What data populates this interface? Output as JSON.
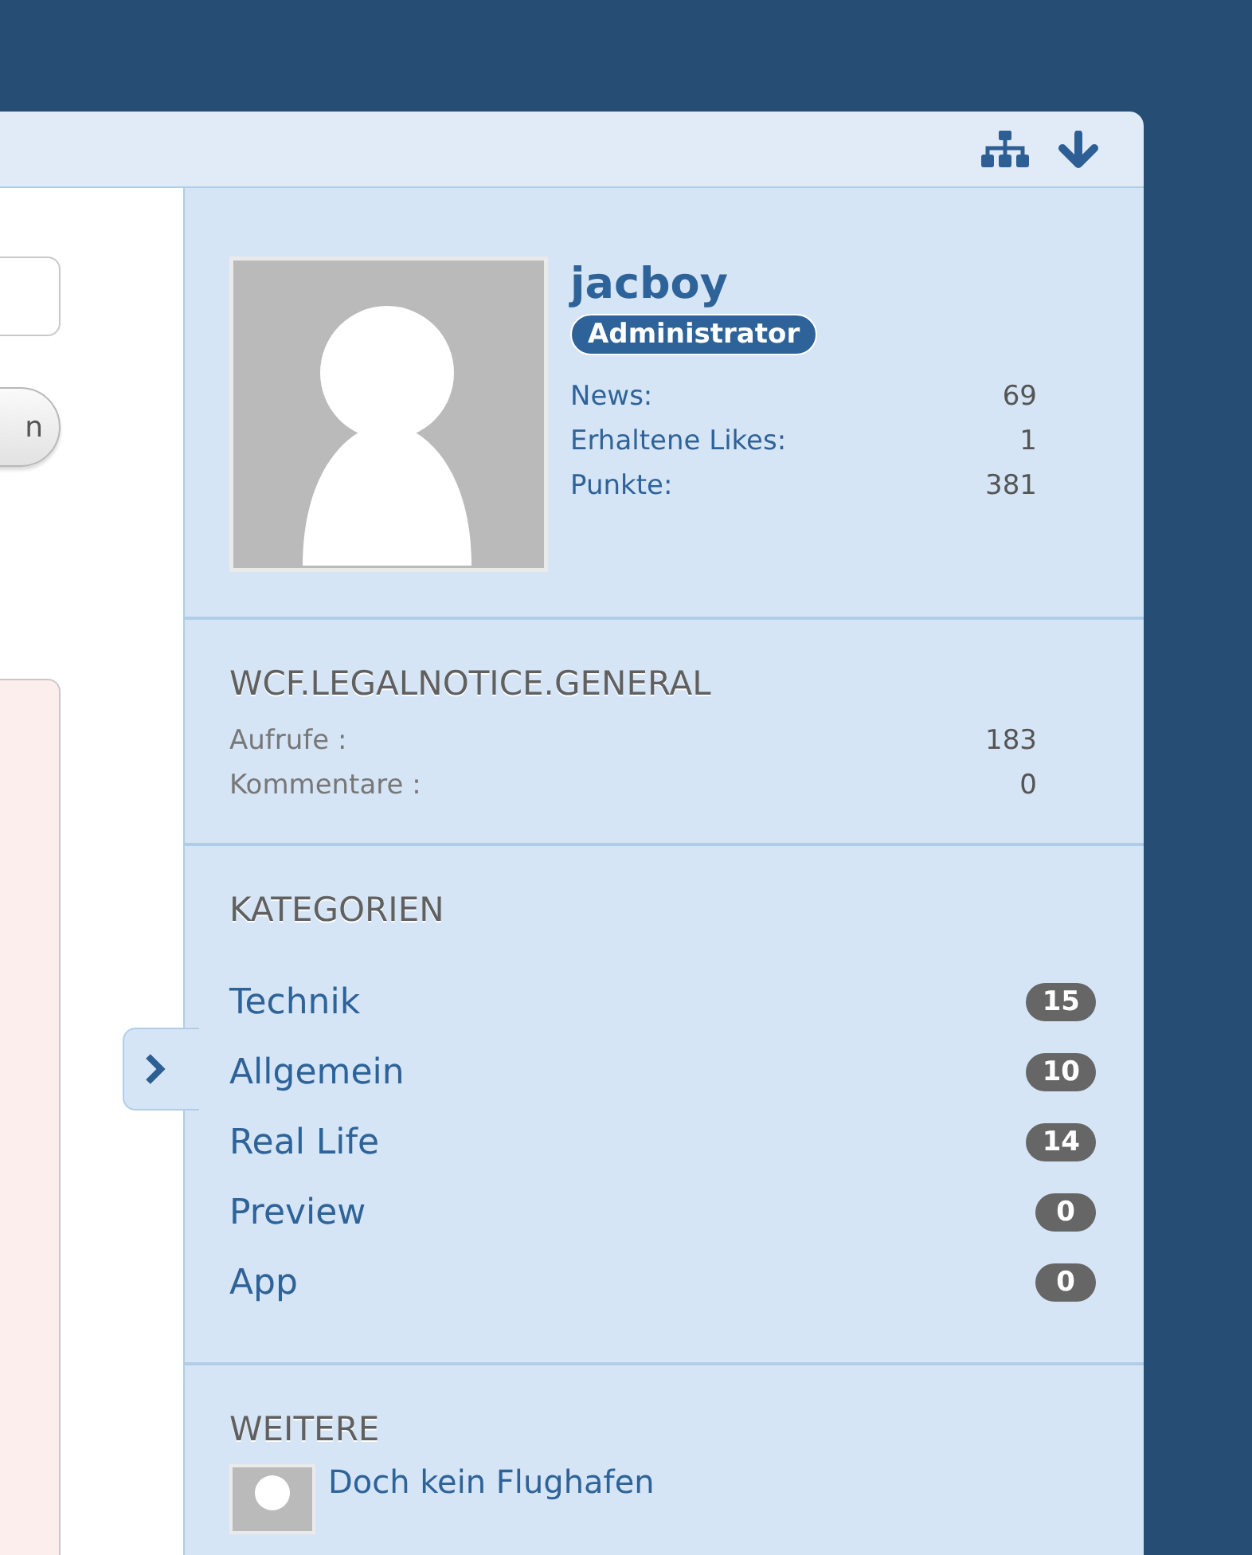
{
  "left": {
    "button_label": "n"
  },
  "profile": {
    "username": "jacboy",
    "rank": "Administrator",
    "stats": [
      {
        "label": "News:",
        "value": "69"
      },
      {
        "label": "Erhaltene Likes:",
        "value": "1"
      },
      {
        "label": "Punkte:",
        "value": "381"
      }
    ]
  },
  "legal": {
    "title": "WCF.LEGALNOTICE.GENERAL",
    "stats": [
      {
        "label": "Aufrufe :",
        "value": "183"
      },
      {
        "label": "Kommentare :",
        "value": "0"
      }
    ]
  },
  "categories": {
    "title": "KATEGORIEN",
    "items": [
      {
        "name": "Technik",
        "count": "15"
      },
      {
        "name": "Allgemein",
        "count": "10"
      },
      {
        "name": "Real Life",
        "count": "14"
      },
      {
        "name": "Preview",
        "count": "0"
      },
      {
        "name": "App",
        "count": "0"
      }
    ]
  },
  "more": {
    "title": "WEITERE",
    "items": [
      {
        "title": "Doch kein Flughafen"
      }
    ]
  }
}
